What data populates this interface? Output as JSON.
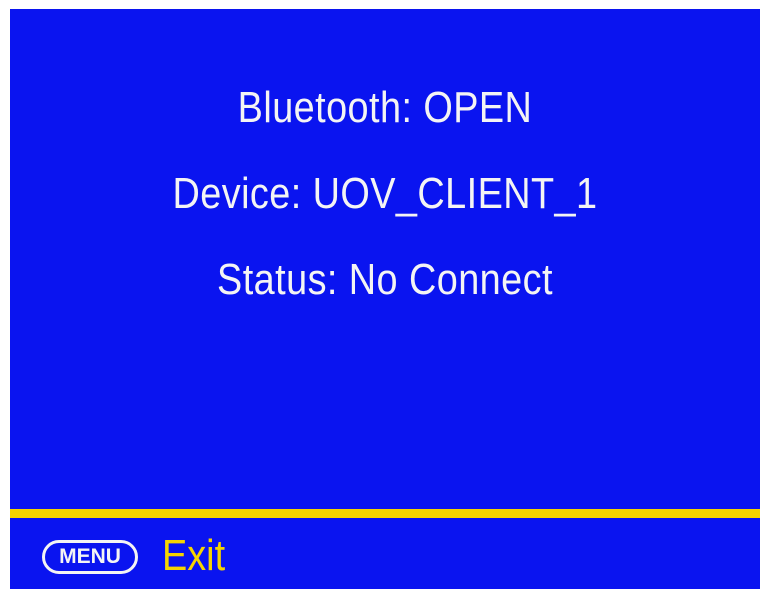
{
  "status_panel": {
    "bluetooth": "Bluetooth: OPEN",
    "device": "Device: UOV_CLIENT_1",
    "status": "Status: No Connect"
  },
  "footer": {
    "menu_key": "MENU",
    "exit_label": "Exit"
  },
  "colors": {
    "background": "#0a14f0",
    "text": "#f4f4f4",
    "accent": "#f5d400"
  }
}
